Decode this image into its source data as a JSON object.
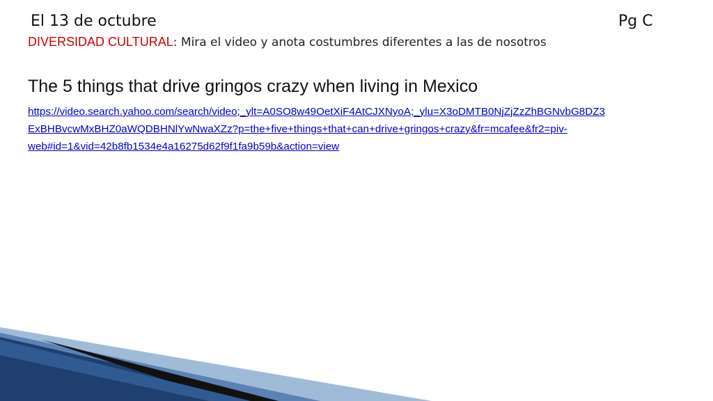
{
  "header": {
    "date": "El 13 de octubre",
    "page": "Pg C"
  },
  "subtitle": {
    "label": "DIVERSIDAD CULTURAL",
    "text": ": Mira el video y anota costumbres diferentes a las de nosotros"
  },
  "heading": "The 5 things that drive gringos crazy when living in Mexico",
  "link": {
    "lines": [
      "https://video.search.yahoo.com/search/video;_ylt=A0SO8w49OetXiF4AtCJXNyoA;_ylu=X3oDMTB0NjZjZzZhBGNvbG8DZ3",
      "ExBHBvcwMxBHZ0aWQDBHNlYwNwaXZz?p=the+five+things+that+can+drive+gringos+crazy&fr=mcafee&fr2=piv-",
      "web#id=1&vid=42b8fb1534e4a16275d62f9f1fa9b59b&action=view"
    ]
  },
  "colors": {
    "label_red": "#cc0000",
    "link_blue": "#0000cc",
    "deco_dark_blue": "#1f3f6e",
    "deco_light_blue": "#9fbbd8"
  }
}
